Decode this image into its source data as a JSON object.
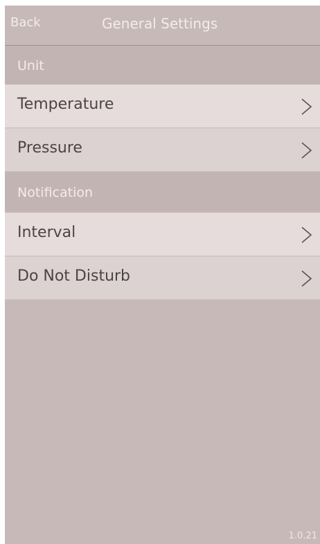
{
  "navbar": {
    "back_label": "Back",
    "title": "General Settings"
  },
  "sections": {
    "unit": {
      "label": "Unit",
      "items": [
        "Temperature",
        "Pressure"
      ]
    },
    "notification": {
      "label": "Notification",
      "items": [
        "Interval",
        "Do Not Disturb"
      ]
    }
  },
  "footer": {
    "version": "1.0.21"
  },
  "icons": {
    "row_chevron": "chevron-right-icon"
  },
  "colors": {
    "background": "#c7b9b8",
    "row_light": "#e7dcdc",
    "row_mid": "#dcd2d1",
    "text_dark": "#4d4444",
    "text_light": "#f2eceb"
  }
}
